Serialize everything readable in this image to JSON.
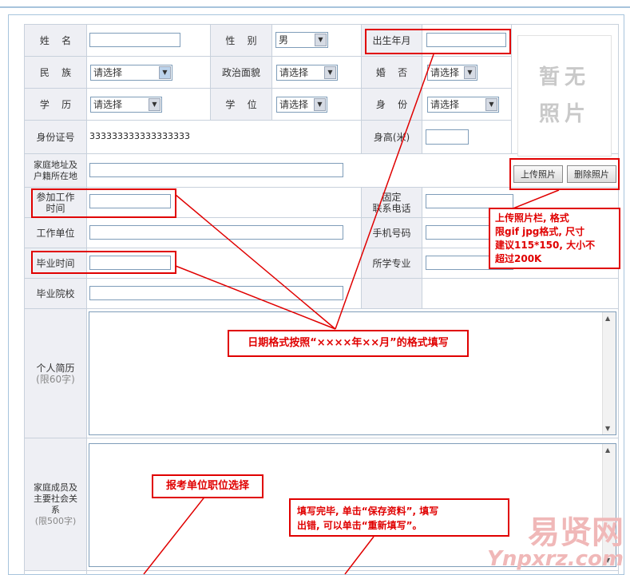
{
  "form": {
    "labels": {
      "name": "姓    名",
      "gender": "性    别",
      "birth": "出生年月",
      "ethnicity": "民    族",
      "political": "政治面貌",
      "marital": "婚    否",
      "education": "学    历",
      "degree": "学    位",
      "identity": "身    份",
      "idnum": "身份证号",
      "height": "身高(米)",
      "address_l1": "家庭地址及",
      "address_l2": "户籍所在地",
      "work_start_l1": "参加工作",
      "work_start_l2": "时间",
      "phone_l1": "固定",
      "phone_l2": "联系电话",
      "employer": "工作单位",
      "mobile": "手机号码",
      "grad_time": "毕业时间",
      "major": "所学专业",
      "school": "毕业院校",
      "resume": "个人简历",
      "resume_limit": "(限60字)",
      "family_l1": "家庭成员及",
      "family_l2": "主要社会关",
      "family_l3": "系",
      "family_limit": "(限500字)"
    },
    "values": {
      "gender": "男",
      "ethnicity": "请选择",
      "political": "请选择",
      "marital": "请选择",
      "education": "请选择",
      "degree": "请选择",
      "identity": "请选择",
      "idnum": "333333333333333333"
    }
  },
  "photo": {
    "placeholder_line1": "暂无",
    "placeholder_line2": "照片",
    "upload_button": "上传照片",
    "delete_button": "删除照片"
  },
  "notes": {
    "photo_l1": "上传照片栏, 格式",
    "photo_l2": "限gif jpg格式, 尺寸",
    "photo_l3": "建议115*150, 大小不",
    "photo_l4": "超过200K",
    "date_format": "日期格式按照“××××年××月”的格式填写",
    "position": "报考单位职位选择",
    "save_l1": "填写完毕, 单击“保存资料”, 填写",
    "save_l2": "出错, 可以单击“重新填写”。"
  },
  "watermark": {
    "text": "易贤网",
    "url": "Ynpxrz.com"
  },
  "colors": {
    "annotation_red": "#e00000",
    "label_bg": "#eeeff4",
    "border_blue": "#7f9db9"
  }
}
